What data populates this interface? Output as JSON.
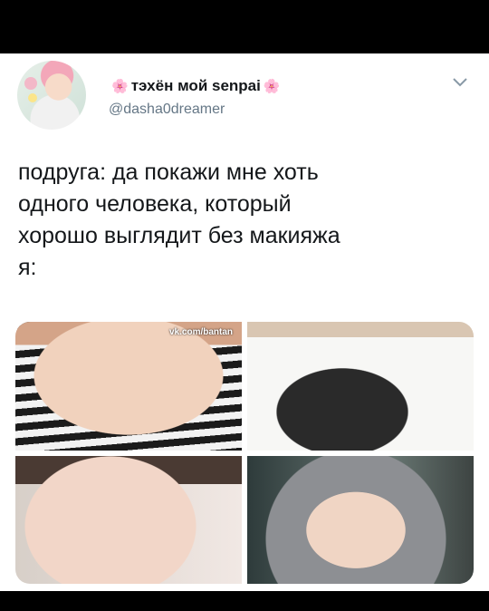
{
  "tweet": {
    "display_name": "тэхён мой senpai",
    "handle": "@dasha0dreamer",
    "text_lines": [
      "подруга: да покажи мне хоть",
      "одного человека, который",
      "хорошо выглядит без макияжа",
      "я:"
    ],
    "watermark": "vk.com/bantan",
    "emoji_left": "🌸",
    "emoji_right": "🌸"
  },
  "icons": [
    "chevron-down-icon",
    "sakura-icon",
    "avatar-image",
    "photo"
  ],
  "colors": {
    "background": "#000000",
    "card": "#ffffff",
    "text": "#14171a",
    "secondary": "#657786",
    "sakura": "#f5a3c0"
  }
}
